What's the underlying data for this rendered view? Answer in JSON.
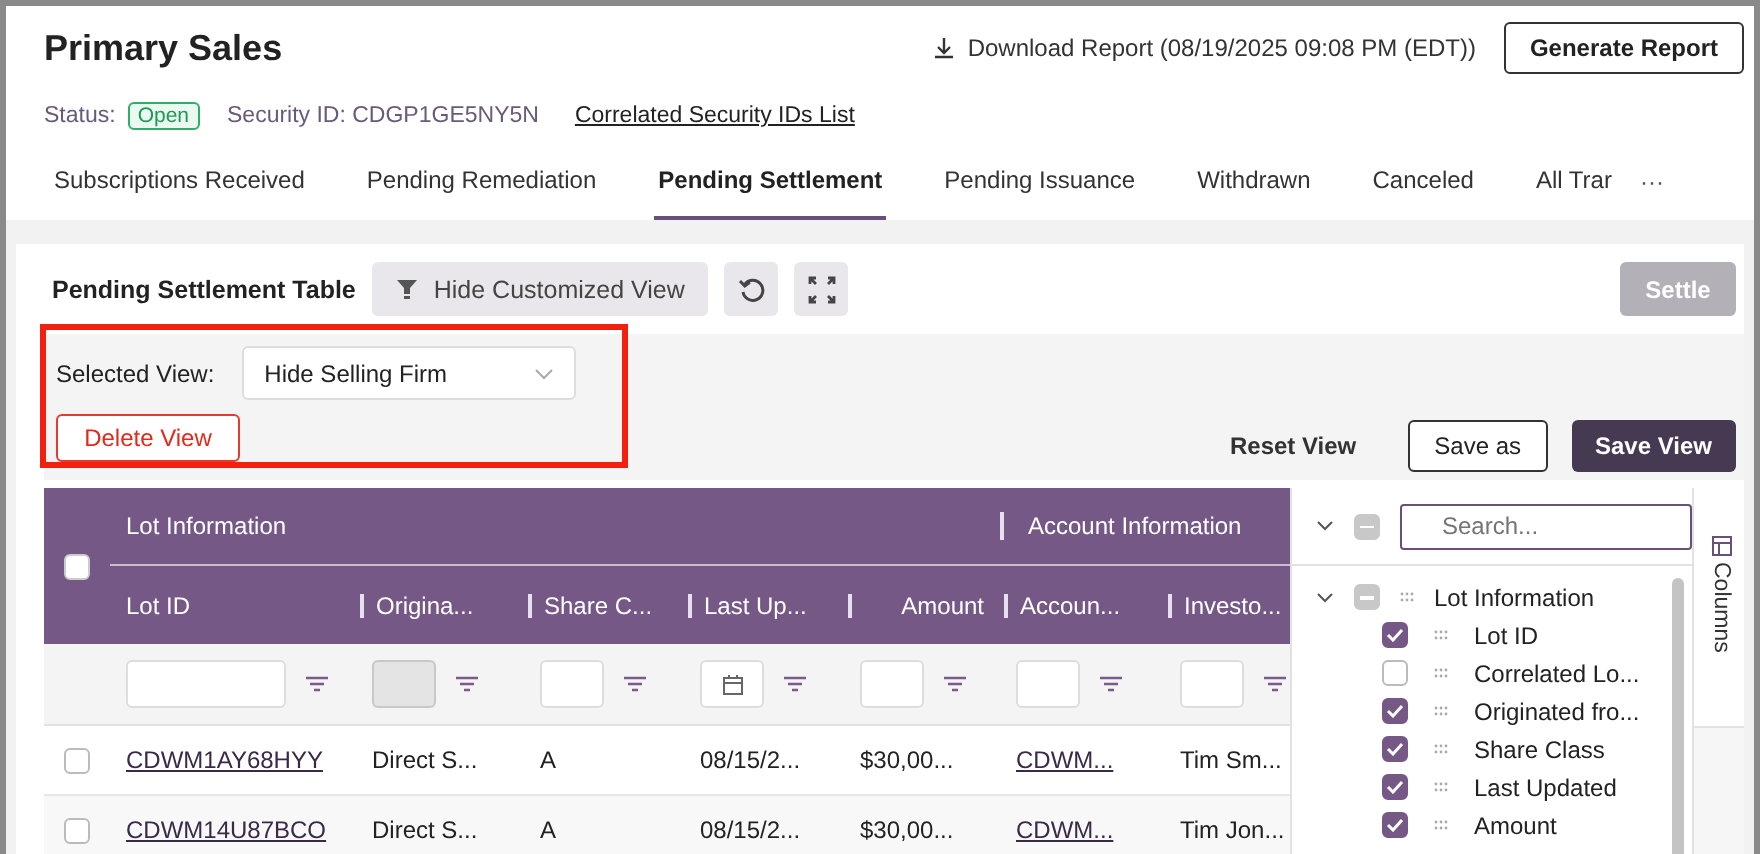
{
  "header": {
    "title": "Primary Sales",
    "download": "Download Report (08/19/2025 09:08 PM (EDT))",
    "generate_button": "Generate Report"
  },
  "status_row": {
    "label": "Status:",
    "badge": "Open",
    "security_id": "Security ID: CDGP1GE5NY5N",
    "link": "Correlated Security IDs List"
  },
  "tabs": [
    {
      "label": "Subscriptions Received",
      "selected": false
    },
    {
      "label": "Pending Remediation",
      "selected": false
    },
    {
      "label": "Pending Settlement",
      "selected": true
    },
    {
      "label": "Pending Issuance",
      "selected": false
    },
    {
      "label": "Withdrawn",
      "selected": false
    },
    {
      "label": "Canceled",
      "selected": false
    },
    {
      "label": "All Trar",
      "selected": false
    }
  ],
  "tabs_more": "···",
  "toolbar": {
    "title": "Pending Settlement Table",
    "toggle_button": "Hide Customized View",
    "settle_button": {
      "label": "Settle",
      "disabled": true
    }
  },
  "view_controls": {
    "highlighted": true,
    "label": "Selected View:",
    "selected_view": "Hide Selling Firm",
    "delete_button": "Delete View",
    "reset_button": "Reset View",
    "save_as_button": "Save as",
    "save_button": "Save View"
  },
  "table": {
    "header_checked": false,
    "groups": [
      {
        "label": "Lot Information"
      },
      {
        "label": "Account Information"
      }
    ],
    "columns": [
      {
        "label": "Lot ID"
      },
      {
        "label": "Origina..."
      },
      {
        "label": "Share C..."
      },
      {
        "label": "Last Up..."
      },
      {
        "label": "Amount"
      },
      {
        "label": "Accoun..."
      },
      {
        "label": "Investo..."
      }
    ],
    "filters": [
      {
        "kind": "text",
        "disabled": false
      },
      {
        "kind": "text",
        "disabled": true
      },
      {
        "kind": "text",
        "disabled": false
      },
      {
        "kind": "date",
        "disabled": false
      },
      {
        "kind": "text",
        "disabled": false
      },
      {
        "kind": "text",
        "disabled": false
      },
      {
        "kind": "text",
        "disabled": false
      }
    ],
    "rows": [
      {
        "selected": false,
        "cells": [
          {
            "kind": "link",
            "text": "CDWM1AY68HYY"
          },
          {
            "kind": "text",
            "text": "Direct S..."
          },
          {
            "kind": "text",
            "text": "A"
          },
          {
            "kind": "text",
            "text": "08/15/2..."
          },
          {
            "kind": "text",
            "text": "$30,00..."
          },
          {
            "kind": "link",
            "text": "CDWM..."
          },
          {
            "kind": "text",
            "text": "Tim Sm..."
          }
        ]
      },
      {
        "selected": false,
        "cells": [
          {
            "kind": "link",
            "text": "CDWM14U87BCO"
          },
          {
            "kind": "text",
            "text": "Direct S..."
          },
          {
            "kind": "text",
            "text": "A"
          },
          {
            "kind": "text",
            "text": "08/15/2..."
          },
          {
            "kind": "text",
            "text": "$30,00..."
          },
          {
            "kind": "link",
            "text": "CDWM..."
          },
          {
            "kind": "text",
            "text": "Tim Jon..."
          }
        ]
      }
    ]
  },
  "column_panel": {
    "expanded": true,
    "indeterminate": true,
    "search_placeholder": "Search...",
    "tab_label": "Columns",
    "groups": [
      {
        "label": "Lot Information",
        "expanded": true,
        "indeterminate": true,
        "children": [
          {
            "label": "Lot ID",
            "checked": true
          },
          {
            "label": "Correlated Lo...",
            "checked": false
          },
          {
            "label": "Originated fro...",
            "checked": true
          },
          {
            "label": "Share Class",
            "checked": true
          },
          {
            "label": "Last Updated",
            "checked": true
          },
          {
            "label": "Amount",
            "checked": true
          }
        ]
      }
    ]
  }
}
